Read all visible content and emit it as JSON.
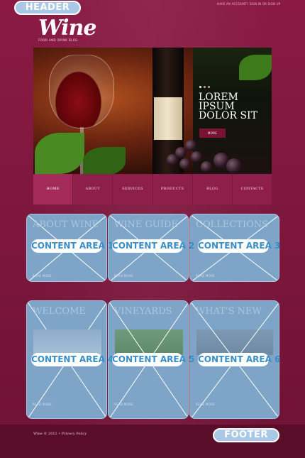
{
  "labels": {
    "header": "HEADER",
    "footer": "FOOTER"
  },
  "top_bar": {
    "account_text": "HAVE AN ACCOUNT? SIGN IN OR SIGN UP"
  },
  "brand": {
    "logo": "Wine",
    "tagline": "FOOD AND DRINK BLOG"
  },
  "slider": {
    "caption": "LOREM IPSUM DOLOR SIT",
    "more_label": "MORE",
    "slide_count": 3,
    "active_slide": 1
  },
  "nav": {
    "items": [
      {
        "label": "HOME",
        "active": true
      },
      {
        "label": "ABOUT",
        "active": false
      },
      {
        "label": "SERVICES",
        "active": false
      },
      {
        "label": "PRODUCTS",
        "active": false
      },
      {
        "label": "BLOG",
        "active": false
      },
      {
        "label": "CONTACTS",
        "active": false
      }
    ]
  },
  "content_areas": [
    {
      "title": "ABOUT WINE",
      "label": "CONTENT AREA 1",
      "more": "READ MORE"
    },
    {
      "title": "WINE GUIDE",
      "label": "CONTENT AREA 2",
      "more": "READ MORE"
    },
    {
      "title": "COLLECTIONS",
      "label": "CONTENT AREA 3",
      "more": "READ MORE"
    },
    {
      "title": "WELCOME",
      "label": "CONTENT AREA 4",
      "more": "READ MORE"
    },
    {
      "title": "VINEYARDS",
      "label": "CONTENT AREA 5",
      "more": "READ MORE"
    },
    {
      "title": "WHAT'S NEW",
      "label": "CONTENT AREA 6",
      "more": "READ MORE"
    }
  ],
  "footer": {
    "copyright": "Wine © 2012 • Privacy Policy"
  },
  "colors": {
    "background": "#7e173d",
    "placeholder_fill": "#7ea4c8",
    "label_text": "#3a8fc9",
    "nav": "#8e1e4a"
  }
}
